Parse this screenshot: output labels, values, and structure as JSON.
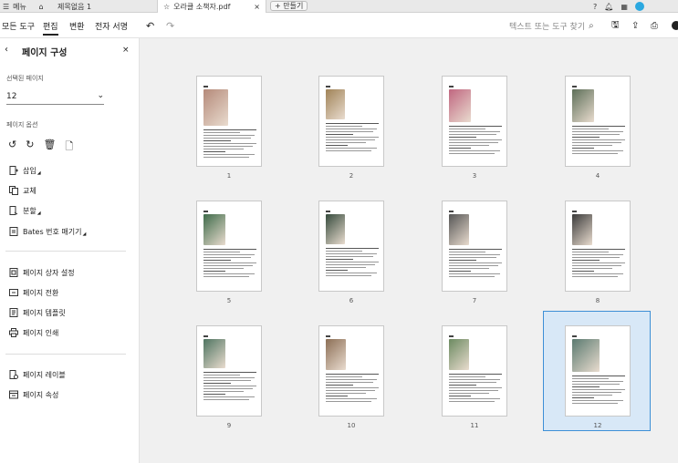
{
  "tabbar": {
    "menu_label": "메뉴",
    "tab1": "제목없음 1",
    "tab2": "오라클 소책자.pdf",
    "new_tab": "+ 만들기"
  },
  "toolbar": {
    "all_tools": "모든 도구",
    "edit": "편집",
    "convert": "변환",
    "esign": "전자 서명",
    "search_placeholder": "텍스트 또는 도구 찾기"
  },
  "panel": {
    "title": "페이지 구성",
    "selected_pages_label": "선택된 페이지",
    "selected_pages_value": "12",
    "page_options_label": "페이지 옵션",
    "items_group1": [
      "삽입",
      "교체",
      "분할",
      "Bates 번호 매기기"
    ],
    "items_group2": [
      "페이지 상자 설정",
      "페이지 전환",
      "페이지 템플릿",
      "페이지 인쇄"
    ],
    "items_group3": [
      "페이지 레이블",
      "페이지 속성"
    ]
  },
  "pages": [
    {
      "num": "1",
      "img_color": "#b58a7a"
    },
    {
      "num": "2",
      "img_color": "#a08357"
    },
    {
      "num": "3",
      "img_color": "#c06680"
    },
    {
      "num": "4",
      "img_color": "#5d6f58"
    },
    {
      "num": "5",
      "img_color": "#3e6b4a"
    },
    {
      "num": "6",
      "img_color": "#354a3c"
    },
    {
      "num": "7",
      "img_color": "#555555"
    },
    {
      "num": "8",
      "img_color": "#3a3a3a"
    },
    {
      "num": "9",
      "img_color": "#4e7460"
    },
    {
      "num": "10",
      "img_color": "#8c6e55"
    },
    {
      "num": "11",
      "img_color": "#6b8a60"
    },
    {
      "num": "12",
      "img_color": "#5a7a70"
    }
  ],
  "selected_page": "12",
  "colors": {
    "accent": "#3d8fd6",
    "selected_bg": "#d8e8f7",
    "main_bg": "#f0f0f0"
  }
}
